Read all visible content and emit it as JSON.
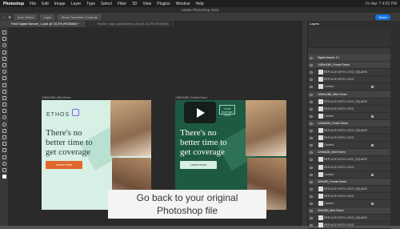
{
  "menubar": {
    "app": "Photoshop",
    "items": [
      "File",
      "Edit",
      "Image",
      "Layer",
      "Type",
      "Select",
      "Filter",
      "3D",
      "View",
      "Plugins",
      "Window",
      "Help"
    ],
    "right": "Fri Apr 7 4:05 PM"
  },
  "title": "Adobe Photoshop 2023",
  "optbar": {
    "autoselect": "Auto-Select",
    "layer": "Layer",
    "transform": "Show Transform Controls",
    "share": "Share"
  },
  "tabs": [
    {
      "label": "Paid Digital Banner_1.psd @ 33.3% (RGB/8#) *",
      "active": true
    },
    {
      "label": "Partner logo placeholder1.psd @ 33.3% (RGB/8#)",
      "active": false
    }
  ],
  "board1": {
    "label": "1080x1080_Mint Green",
    "logo": "ETHOS",
    "headline_1": "There's no",
    "headline_2": "better time to",
    "headline_3": "get coverage",
    "cta": "Learn more"
  },
  "board2": {
    "label": "1080x1080_Forest Green",
    "badge": "YOUR PARTNER LOGO",
    "headline_1": "There's no",
    "headline_2": "better time to",
    "headline_3": "get coverage",
    "cta": "Learn more"
  },
  "caption": {
    "line1": "Go back to your original",
    "line2": "Photoshop file"
  },
  "layers": {
    "panel_title": "Layers",
    "rows": [
      {
        "type": "group",
        "label": "Digital banner # 1"
      },
      {
        "type": "group",
        "label": "1080x1080_Forest Green"
      },
      {
        "type": "child",
        "label": "REPLACE WITH LOGO_SQUARE"
      },
      {
        "type": "child",
        "label": "REPLACE WITH LOGO"
      },
      {
        "type": "child",
        "label": "Content"
      },
      {
        "type": "group",
        "label": "1080x1080_Mint Green"
      },
      {
        "type": "child",
        "label": "REPLACE WITH LOGO_SQUARE"
      },
      {
        "type": "child",
        "label": "REPLACE WITH LOGO"
      },
      {
        "type": "child",
        "label": "Content"
      },
      {
        "type": "group",
        "label": "1200x628_Forest Green"
      },
      {
        "type": "child",
        "label": "REPLACE WITH LOGO_SQUARE"
      },
      {
        "type": "child",
        "label": "REPLACE WITH LOGO"
      },
      {
        "type": "child",
        "label": "Content"
      },
      {
        "type": "group",
        "label": "1200x628_Mint Green"
      },
      {
        "type": "child",
        "label": "REPLACE WITH LOGO_SQUARE"
      },
      {
        "type": "child",
        "label": "REPLACE WITH LOGO"
      },
      {
        "type": "child",
        "label": "Content"
      },
      {
        "type": "group",
        "label": "300x250_Forest Green"
      },
      {
        "type": "child",
        "label": "REPLACE WITH LOGO_SQUARE"
      },
      {
        "type": "child",
        "label": "REPLACE WITH LOGO"
      },
      {
        "type": "child",
        "label": "Content"
      },
      {
        "type": "group",
        "label": "300x250_Mint Green"
      },
      {
        "type": "child",
        "label": "REPLACE WITH LOGO_SQUARE"
      },
      {
        "type": "child",
        "label": "REPLACE WITH LOGO"
      }
    ]
  },
  "colors": {
    "mint": "#d8efe5",
    "forest": "#1e5a42",
    "cta_orange": "#e0682a",
    "accent": "#1473e6"
  }
}
